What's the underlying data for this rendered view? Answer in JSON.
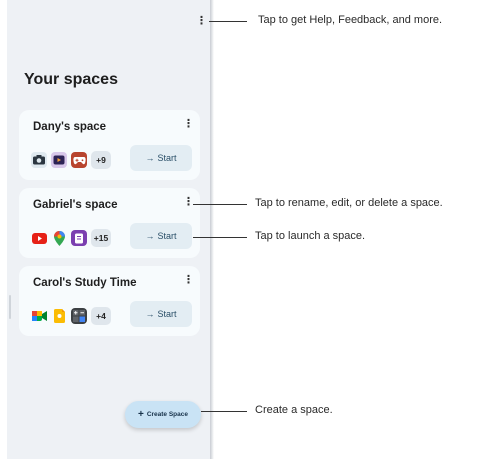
{
  "panel": {
    "title": "Your spaces",
    "create_button": {
      "icon": "plus-icon",
      "label": "Create Space"
    }
  },
  "spaces": [
    {
      "name": "Dany's space",
      "apps": [
        "camera-icon",
        "video-icon",
        "game-controller-icon"
      ],
      "more": "+9",
      "start": "Start"
    },
    {
      "name": "Gabriel's  space",
      "apps": [
        "youtube-icon",
        "maps-icon",
        "purple-app-icon"
      ],
      "more": "+15",
      "start": "Start"
    },
    {
      "name": "Carol's Study Time",
      "apps": [
        "meet-icon",
        "keep-icon",
        "calculator-icon"
      ],
      "more": "+4",
      "start": "Start"
    }
  ],
  "annotations": {
    "help": "Tap to get Help, Feedback, and more.",
    "rename": "Tap to rename, edit, or delete a space.",
    "launch": "Tap to launch a space.",
    "create": "Create a space."
  },
  "colors": {
    "panel_bg": "#eef1f5",
    "card_bg": "#f7fbfd",
    "start_bg": "#e3edf3",
    "fab_bg": "#c9e3f5"
  }
}
